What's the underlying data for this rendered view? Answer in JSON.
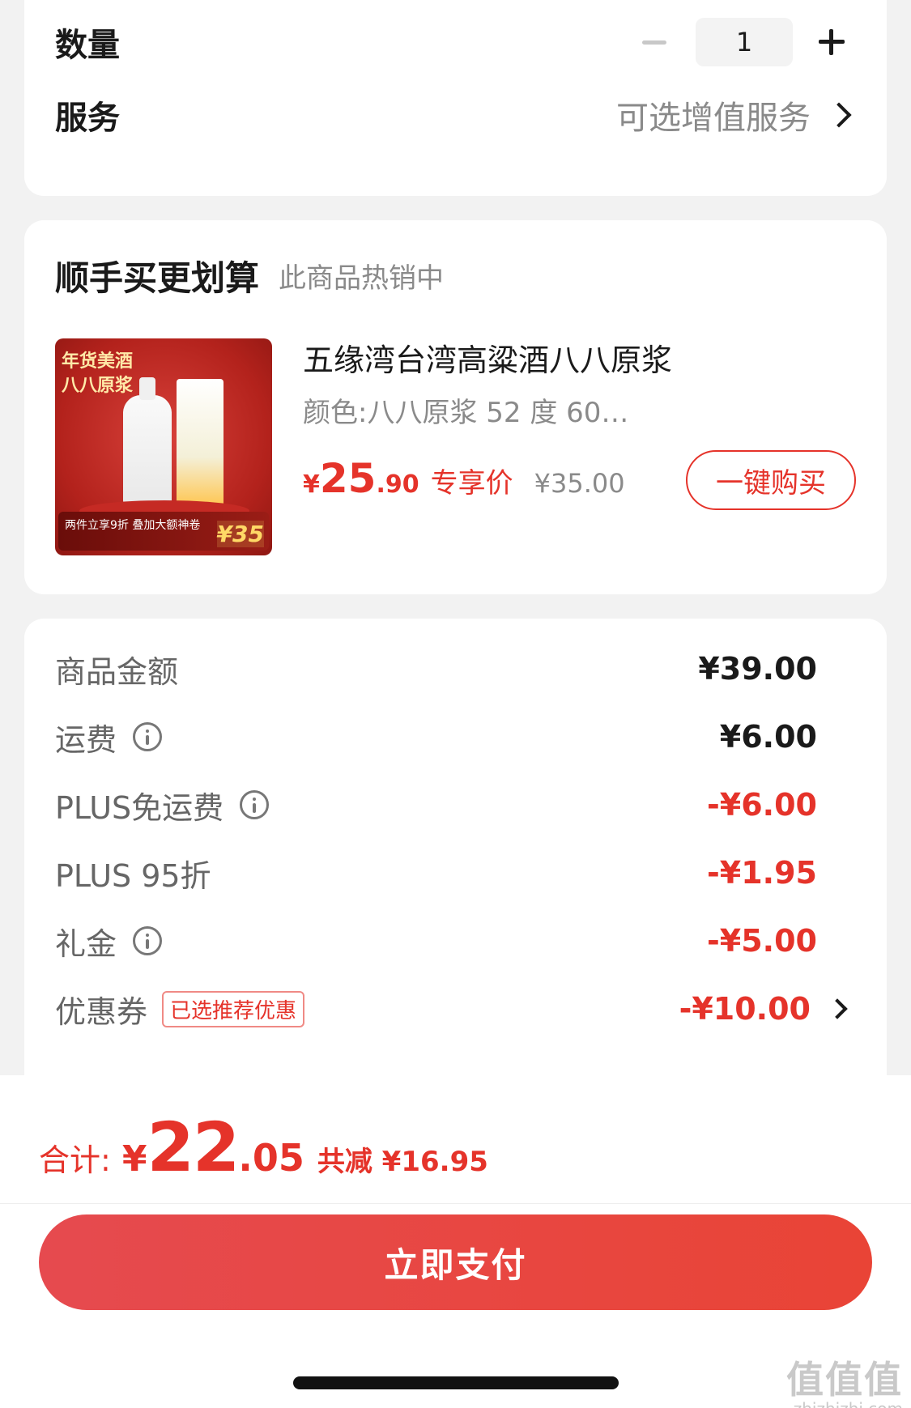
{
  "quantity": {
    "label": "数量",
    "value": "1"
  },
  "service": {
    "label": "服务",
    "value": "可选增值服务"
  },
  "upsell": {
    "title": "顺手买更划算",
    "subtitle": "此商品热销中",
    "product": {
      "image_tag_line1": "年货美酒",
      "image_tag_line2": "八八原浆",
      "image_banner": "两件立享9折 叠加大额神卷",
      "image_price": "¥35",
      "name": "五缘湾台湾高粱酒八八原浆",
      "spec": "颜色:八八原浆 52 度 600...",
      "price_yen": "¥",
      "price_int": "25",
      "price_dec": ".90",
      "price_tag": "专享价",
      "original_price": "¥35.00",
      "buy_label": "一键购买"
    }
  },
  "summary": {
    "goods_amount": {
      "label": "商品金额",
      "value": "¥39.00"
    },
    "shipping": {
      "label": "运费",
      "value": "¥6.00"
    },
    "plus_free_shipping": {
      "label": "PLUS免运费",
      "value": "-¥6.00"
    },
    "plus_discount": {
      "label": "PLUS 95折",
      "value": "-¥1.95"
    },
    "gift_money": {
      "label": "礼金",
      "value": "-¥5.00"
    },
    "coupon": {
      "label": "优惠券",
      "tag": "已选推荐优惠",
      "value": "-¥10.00"
    }
  },
  "total": {
    "label": "合计:",
    "yen": "¥",
    "int": "22",
    "dec": ".05",
    "reduced": "共减 ¥16.95"
  },
  "pay_button": "立即支付",
  "watermark": {
    "big": "值值值",
    "small": "zhizhizhi.com"
  },
  "colors": {
    "accent": "#e5332a",
    "pay_gradient_start": "#e64a4f",
    "pay_gradient_end": "#e94436"
  }
}
